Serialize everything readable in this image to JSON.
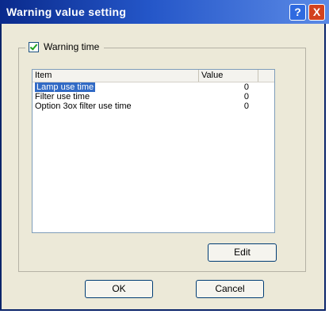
{
  "window": {
    "title": "Warning value setting",
    "help_glyph": "?",
    "close_glyph": "X"
  },
  "group": {
    "checkbox_label": "Warning time",
    "checked": true
  },
  "table": {
    "columns": [
      "Item",
      "Value"
    ],
    "rows": [
      {
        "item": "Lamp use time",
        "value": "0",
        "selected": true
      },
      {
        "item": "Filter use time",
        "value": "0",
        "selected": false
      },
      {
        "item": "Option 3ox filter use time",
        "value": "0",
        "selected": false
      }
    ]
  },
  "buttons": {
    "edit": "Edit",
    "ok": "OK",
    "cancel": "Cancel"
  },
  "colors": {
    "title_bar_start": "#0a2a8c",
    "title_bar_end": "#5b8ae6",
    "selection": "#316ac5",
    "dialog_bg": "#ece9d8"
  }
}
